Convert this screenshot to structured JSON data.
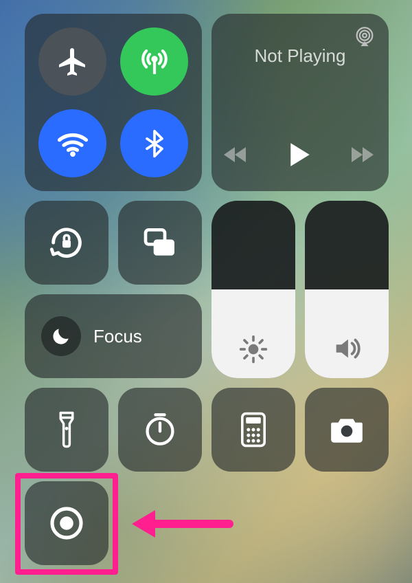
{
  "connectivity": {
    "airplane": {
      "on": false
    },
    "cellular": {
      "on": true
    },
    "wifi": {
      "on": true
    },
    "bluetooth": {
      "on": true
    }
  },
  "media": {
    "now_playing_label": "Not Playing"
  },
  "focus": {
    "label": "Focus"
  },
  "brightness": {
    "level_pct": 50
  },
  "volume": {
    "level_pct": 50
  },
  "colors": {
    "accent_green": "#34c759",
    "accent_blue": "#2a6cff",
    "tile_bg": "rgba(35,40,42,0.62)",
    "highlight": "#ff1f8f"
  },
  "annotation": {
    "target": "screen-record-button",
    "arrow_direction": "left"
  }
}
